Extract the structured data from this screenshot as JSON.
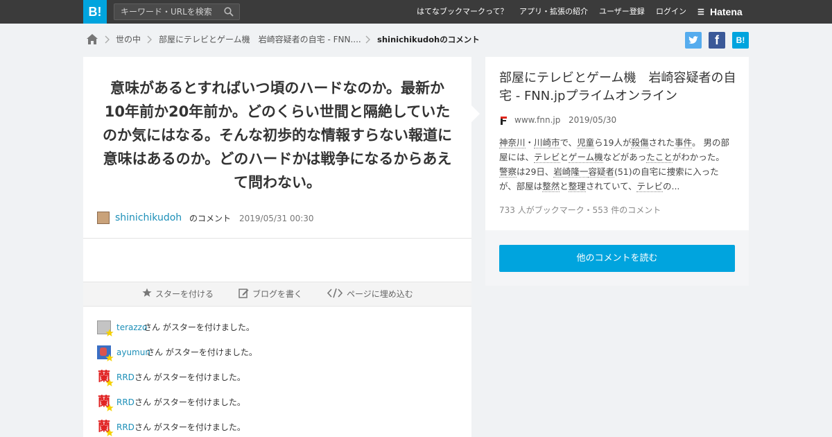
{
  "header": {
    "logo": "B!",
    "search_placeholder": "キーワード・URLを検索",
    "nav": [
      "はてなブックマークって？",
      "アプリ・拡張の紹介",
      "ユーザー登録",
      "ログイン"
    ],
    "brand": "Hatena"
  },
  "breadcrumb": {
    "items": [
      "世の中",
      "部屋にテレビとゲーム機　岩崎容疑者の自宅 - FNN....",
      "shinichikudohのコメント"
    ]
  },
  "share": {
    "twitter": "t",
    "facebook": "f",
    "hatena": "B!"
  },
  "comment": {
    "text": "意味があるとすればいつ頃のハードなのか。最新か10年前か20年前か。どのくらい世間と隔絶していたのか気にはなる。そんな初歩的な情報すらない報道に意味はあるのか。どのハードかは戦争になるからあえて問わない。",
    "user": "shinichikudoh",
    "user_suffix": "のコメント",
    "date": "2019/05/31 00:30"
  },
  "tools": {
    "star": "スターを付ける",
    "blog": "ブログを書く",
    "embed": "ページに埋め込む"
  },
  "stars": [
    {
      "user": "terazzo",
      "text": "さん がスターを付けました。",
      "avatar_color": "#b8b8b8"
    },
    {
      "user": "ayumun",
      "text": "さん がスターを付けました。",
      "avatar_color": "#d9534f"
    },
    {
      "user": "RRD",
      "text": "さん がスターを付けました。",
      "avatar_color": "#e02020"
    },
    {
      "user": "RRD",
      "text": "さん がスターを付けました。",
      "avatar_color": "#e02020"
    },
    {
      "user": "RRD",
      "text": "さん がスターを付けました。",
      "avatar_color": "#e02020"
    }
  ],
  "entry": {
    "title": "部屋にテレビとゲーム機　岩崎容疑者の自宅 - FNN.jpプライムオンライン",
    "domain": "www.fnn.jp",
    "date": "2019/05/30",
    "summary_parts": [
      {
        "t": "神奈川",
        "kw": true
      },
      {
        "t": "・",
        "kw": false
      },
      {
        "t": "川崎市",
        "kw": true
      },
      {
        "t": "で、",
        "kw": false
      },
      {
        "t": "児童",
        "kw": true
      },
      {
        "t": "ら19人が",
        "kw": false
      },
      {
        "t": "殺傷",
        "kw": true
      },
      {
        "t": "された",
        "kw": false
      },
      {
        "t": "事件",
        "kw": true
      },
      {
        "t": "。 男の部屋には、",
        "kw": false
      },
      {
        "t": "テレビ",
        "kw": true
      },
      {
        "t": "と",
        "kw": false
      },
      {
        "t": "ゲーム機",
        "kw": true
      },
      {
        "t": "などがあっ",
        "kw": false
      },
      {
        "t": "たこと",
        "kw": true
      },
      {
        "t": "がわかった。 ",
        "kw": false
      },
      {
        "t": "警察",
        "kw": true
      },
      {
        "t": "は29日、",
        "kw": false
      },
      {
        "t": "岩崎隆一",
        "kw": true
      },
      {
        "t": "容疑者",
        "kw": true
      },
      {
        "t": "(51)の自宅に捜索に入ったが、部屋は",
        "kw": false
      },
      {
        "t": "整然",
        "kw": true
      },
      {
        "t": "と",
        "kw": false
      },
      {
        "t": "整理",
        "kw": true
      },
      {
        "t": "されていて、",
        "kw": false
      },
      {
        "t": "テレビ",
        "kw": true
      },
      {
        "t": "の...",
        "kw": false
      }
    ],
    "counts": "733 人がブックマーク・553 件のコメント",
    "more_button": "他のコメントを読む"
  },
  "colors": {
    "accent": "#00a4de",
    "header": "#3b3b3b",
    "link": "#1c8fb8"
  }
}
